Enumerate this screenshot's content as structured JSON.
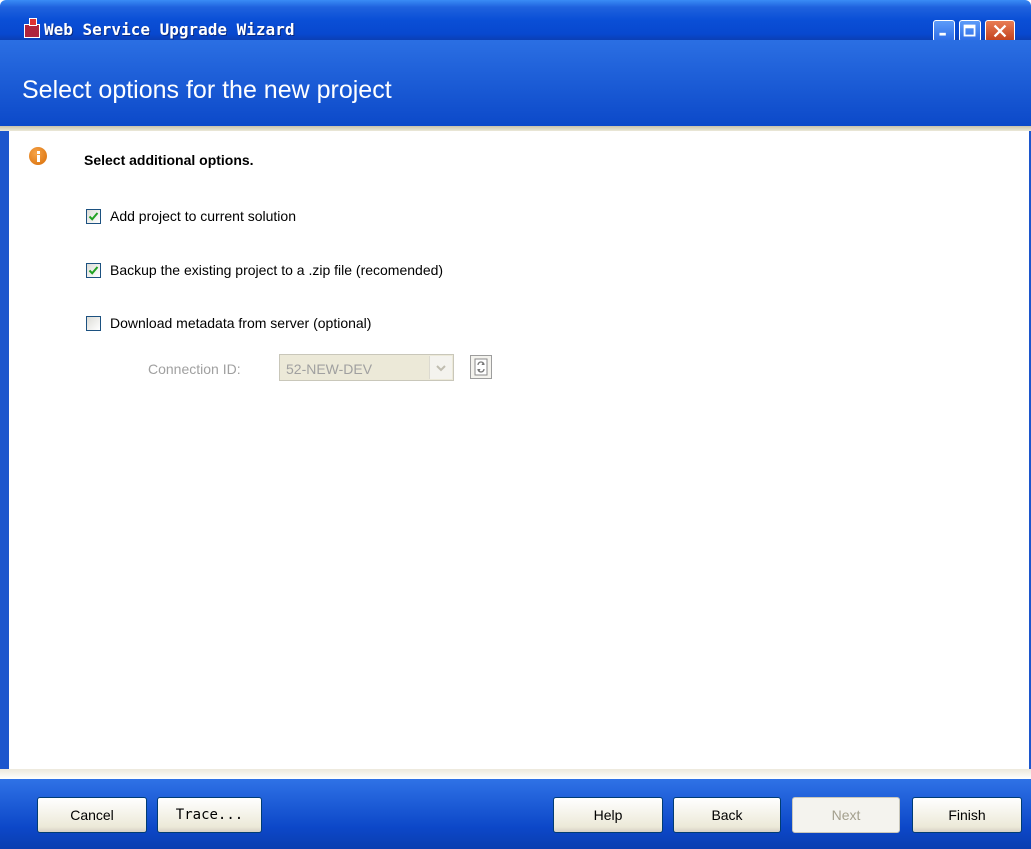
{
  "window": {
    "title": "Web Service Upgrade Wizard"
  },
  "header": {
    "title": "Select options for the new project"
  },
  "content": {
    "heading": "Select additional options.",
    "options": [
      {
        "label": "Add project to current solution",
        "checked": true
      },
      {
        "label": "Backup the existing project to a .zip file  (recomended)",
        "checked": true
      },
      {
        "label": "Download metadata from server (optional)",
        "checked": false
      }
    ],
    "connection": {
      "label": "Connection ID:",
      "value": "52-NEW-DEV",
      "enabled": false
    }
  },
  "footer": {
    "cancel_label": "Cancel",
    "trace_label": "Trace...",
    "help_label": "Help",
    "back_label": "Back",
    "next_label": "Next",
    "finish_label": "Finish",
    "next_enabled": false
  },
  "colors": {
    "title_bar": "#0a4fd6",
    "header": "#1f5fd8",
    "close_button": "#c2401d",
    "info_icon": "#e07a10",
    "disabled_text": "#a0a0a0"
  }
}
